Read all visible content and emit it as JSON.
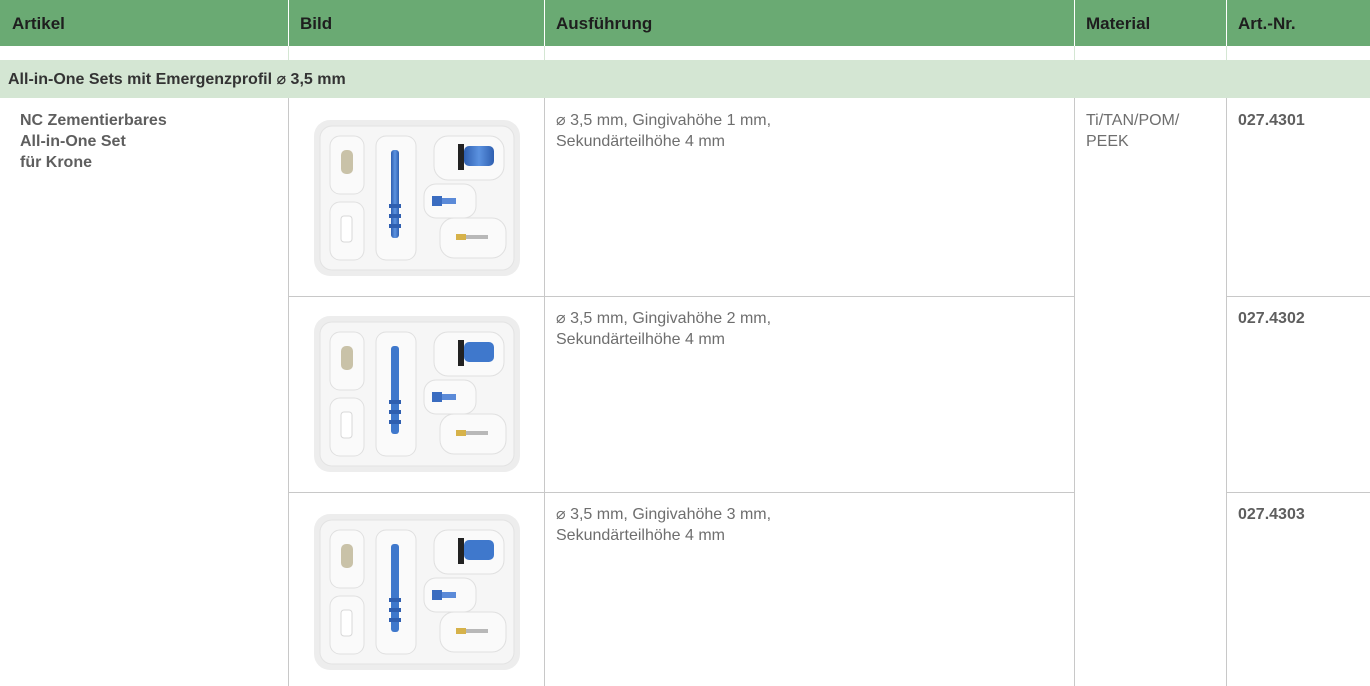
{
  "header": {
    "artikel": "Artikel",
    "bild": "Bild",
    "ausfuehrung": "Ausführung",
    "material": "Material",
    "artnr": "Art.-Nr."
  },
  "section": {
    "title": "All-in-One Sets mit Emergenzprofil ⌀ 3,5 mm"
  },
  "article": {
    "line1": "NC Zementierbares",
    "line2": "All-in-One Set",
    "line3": "für Krone"
  },
  "material": {
    "line1": "Ti/TAN/POM/",
    "line2": "PEEK"
  },
  "rows": [
    {
      "desc1": "⌀ 3,5 mm, Gingivahöhe 1 mm,",
      "desc2": "Sekundärteilhöhe 4 mm",
      "artnr": "027.4301"
    },
    {
      "desc1": "⌀ 3,5 mm, Gingivahöhe 2 mm,",
      "desc2": "Sekundärteilhöhe 4 mm",
      "artnr": "027.4302"
    },
    {
      "desc1": "⌀ 3,5 mm, Gingivahöhe 3 mm,",
      "desc2": "Sekundärteilhöhe 4 mm",
      "artnr": "027.4303"
    }
  ],
  "colors": {
    "header_bg": "#6aaa73",
    "section_bg": "#d4e6d3",
    "implant_blue": "#3a72c4"
  }
}
